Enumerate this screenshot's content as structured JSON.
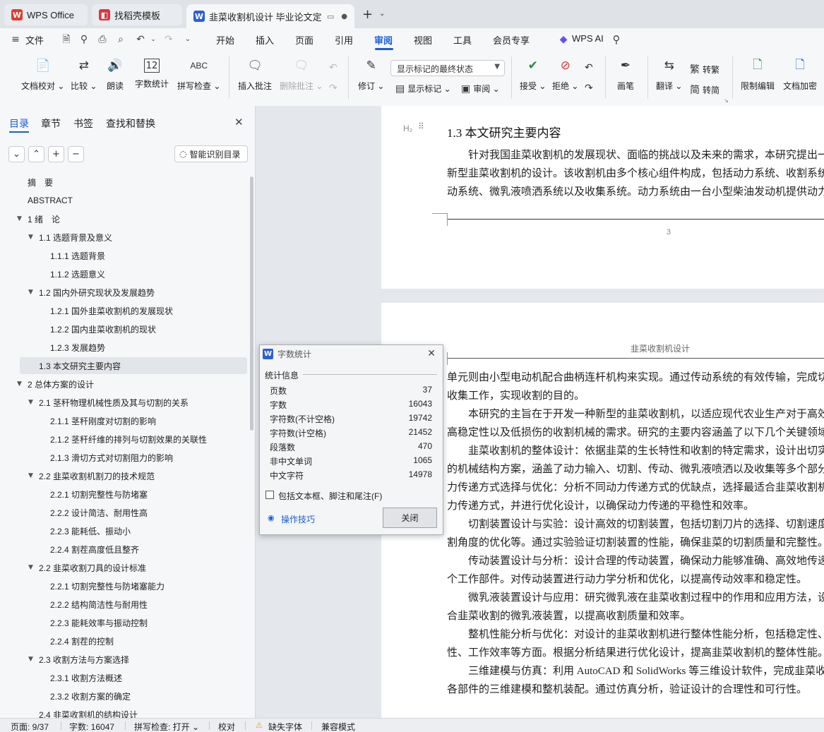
{
  "tabs": [
    {
      "label": "WPS Office",
      "icon": "wps-logo-icon"
    },
    {
      "label": "找稻壳模板",
      "icon": "docer-icon"
    },
    {
      "label": "韭菜收割机设计 毕业论文定稿",
      "icon": "wps-writer-icon"
    }
  ],
  "menu": {
    "file": "文件",
    "items": [
      "开始",
      "插入",
      "页面",
      "引用",
      "审阅",
      "视图",
      "工具",
      "会员专享"
    ],
    "active": "审阅",
    "ai": "WPS AI"
  },
  "ribbon": {
    "doc_proof": "文档校对",
    "compare": "比较",
    "read_aloud": "朗读",
    "word_count": "字数统计",
    "spell_check": "拼写检查",
    "insert_comment": "插入批注",
    "delete_comment": "删除批注",
    "markup_select": "显示标记的最终状态",
    "revise": "修订",
    "show_markup": "显示标记",
    "review": "审阅",
    "accept": "接受",
    "reject": "拒绝",
    "ink": "画笔",
    "translate": "翻译",
    "to_traditional": "转繁",
    "to_simplified": "转简",
    "restrict_edit": "限制编辑",
    "doc_encrypt": "文档加密",
    "abc_label": "ABC",
    "count_label": "12"
  },
  "nav": {
    "tabs": [
      "目录",
      "章节",
      "书签",
      "查找和替换"
    ],
    "smart_toc": "智能识别目录",
    "toc": [
      {
        "text": "摘　要",
        "level": 0,
        "arrow": ""
      },
      {
        "text": "ABSTRACT",
        "level": 0,
        "arrow": ""
      },
      {
        "text": "1 绪　论",
        "level": 0,
        "arrow": "▼"
      },
      {
        "text": "1.1  选题背景及意义",
        "level": 1,
        "arrow": "▼"
      },
      {
        "text": "1.1.1 选题背景",
        "level": 2,
        "arrow": ""
      },
      {
        "text": "1.1.2 选题意义",
        "level": 2,
        "arrow": ""
      },
      {
        "text": "1.2  国内外研究现状及发展趋势",
        "level": 1,
        "arrow": "▼"
      },
      {
        "text": "1.2.1 国外韭菜收割机的发展现状",
        "level": 2,
        "arrow": ""
      },
      {
        "text": "1.2.2 国内韭菜收割机的现状",
        "level": 2,
        "arrow": ""
      },
      {
        "text": "1.2.3  发展趋势",
        "level": 2,
        "arrow": ""
      },
      {
        "text": "1.3  本文研究主要内容",
        "level": 1,
        "arrow": "",
        "selected": true
      },
      {
        "text": "2 总体方案的设计",
        "level": 0,
        "arrow": "▼"
      },
      {
        "text": "2.1 茎秆物理机械性质及其与切割的关系",
        "level": 1,
        "arrow": "▼"
      },
      {
        "text": "2.1.1 茎秆刚度对切割的影响",
        "level": 2,
        "arrow": ""
      },
      {
        "text": "2.1.2  茎秆纤维的排列与切割效果的关联性",
        "level": 2,
        "arrow": ""
      },
      {
        "text": "2.1.3  滑切方式对切割阻力的影响",
        "level": 2,
        "arrow": ""
      },
      {
        "text": "2.2  韭菜收割机割刀的技术规范",
        "level": 1,
        "arrow": "▼"
      },
      {
        "text": "2.2.1  切割完整性与防堵塞",
        "level": 2,
        "arrow": ""
      },
      {
        "text": "2.2.2  设计简洁、耐用性高",
        "level": 2,
        "arrow": ""
      },
      {
        "text": "2.2.3  能耗低、振动小",
        "level": 2,
        "arrow": ""
      },
      {
        "text": "2.2.4  割茬高度低且整齐",
        "level": 2,
        "arrow": ""
      },
      {
        "text": "2.2  韭菜收割刀具的设计标准",
        "level": 1,
        "arrow": "▼"
      },
      {
        "text": "2.2.1  切割完整性与防堵塞能力",
        "level": 2,
        "arrow": ""
      },
      {
        "text": "2.2.2  结构简洁性与耐用性",
        "level": 2,
        "arrow": ""
      },
      {
        "text": "2.2.3  能耗效率与振动控制",
        "level": 2,
        "arrow": ""
      },
      {
        "text": "2.2.4  割茬的控制",
        "level": 2,
        "arrow": ""
      },
      {
        "text": "2.3  收割方法与方案选择",
        "level": 1,
        "arrow": "▼"
      },
      {
        "text": "2.3.1  收割方法概述",
        "level": 2,
        "arrow": ""
      },
      {
        "text": "2.3.2  收割方案的确定",
        "level": 2,
        "arrow": ""
      },
      {
        "text": "2.4  韭菜收割机的结构设计",
        "level": 1,
        "arrow": ""
      }
    ]
  },
  "document": {
    "heading_marker": "H₂",
    "heading": "1.3  本文研究主要内容",
    "page1_lines": [
      "　　针对我国韭菜收割机的发展现状、面临的挑战以及未来的需求，本研究提出一种",
      "新型韭菜收割机的设计。该收割机由多个核心组件构成，包括动力系统、收割系统、传",
      "动系统、微乳液喷洒系统以及收集系统。动力系统由一台小型柴油发动机提供动力，"
    ],
    "page_number": "3",
    "header_text": "韭菜收割机设计",
    "page2_lines": [
      "单元则由小型电动机配合曲柄连杆机构来实现。通过传动系统的有效传输，完成切割和",
      "收集工作，实现收割的目的。",
      "　　本研究的主旨在于开发一种新型的韭菜收割机，以适应现代农业生产对于高效率、",
      "高稳定性以及低损伤的收割机械的需求。研究的主要内容涵盖了以下几个关键领域：",
      "　　韭菜收割机的整体设计：依据韭菜的生长特性和收割的特定需求，设计出切实可行",
      "的机械结构方案，涵盖了动力输入、切割、传动、微乳液喷洒以及收集等多个部分。动",
      "力传递方式选择与优化：分析不同动力传递方式的优缺点，选择最适合韭菜收割机的动",
      "力传递方式，并进行优化设计，以确保动力传递的平稳性和效率。",
      "　　切割装置设计与实验：设计高效的切割装置，包括切割刀片的选择、切割速度和切",
      "割角度的优化等。通过实验验证切割装置的性能，确保韭菜的切割质量和完整性。",
      "　　传动装置设计与分析：设计合理的传动装置，确保动力能够准确、高效地传递到各",
      "个工作部件。对传动装置进行动力学分析和优化，以提高传动效率和稳定性。",
      "　　微乳液装置设计与应用：研究微乳液在韭菜收割过程中的作用和应用方法，设计适",
      "合韭菜收割的微乳液装置，以提高收割质量和效率。",
      "　　整机性能分析与优化：对设计的韭菜收割机进行整体性能分析，包括稳定性、可靠",
      "性、工作效率等方面。根据分析结果进行优化设计，提高韭菜收割机的整体性能。",
      "　　三维建模与仿真：利用 AutoCAD 和 SolidWorks 等三维设计软件，完成韭菜收割机",
      "各部件的三维建模和整机装配。通过仿真分析，验证设计的合理性和可行性。"
    ]
  },
  "dialog": {
    "title": "字数统计",
    "section": "统计信息",
    "rows": [
      {
        "label": "页数",
        "value": "37"
      },
      {
        "label": "字数",
        "value": "16043"
      },
      {
        "label": "字符数(不计空格)",
        "value": "19742"
      },
      {
        "label": "字符数(计空格)",
        "value": "21452"
      },
      {
        "label": "段落数",
        "value": "470"
      },
      {
        "label": "非中文单词",
        "value": "1065"
      },
      {
        "label": "中文字符",
        "value": "14978"
      }
    ],
    "checkbox": "包括文本框、脚注和尾注(F)",
    "tips": "操作技巧",
    "close": "关闭"
  },
  "status": {
    "page": "页面: 9/37",
    "words": "字数: 16047",
    "spell": "拼写检查: 打开",
    "proof": "校对",
    "missing_font": "缺失字体",
    "compat": "兼容模式"
  },
  "colors": {
    "accent": "#1a5dd8",
    "wps_red": "#e03a2f",
    "docer_red": "#d9363e"
  }
}
